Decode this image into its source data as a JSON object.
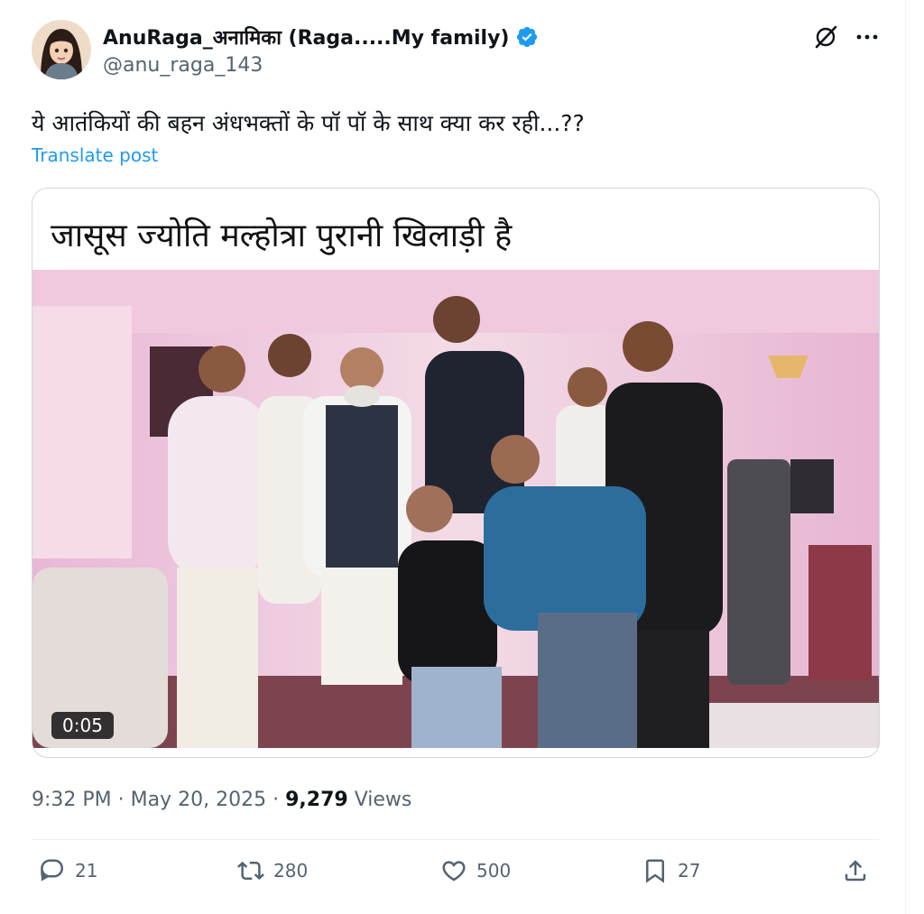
{
  "author": {
    "display_name": "AnuRaga_अनामिका (Raga.....My family)",
    "handle": "@anu_raga_143",
    "verified": true
  },
  "post": {
    "text": "ये आतंकियों की बहन अंधभक्तों के पॉ पॉ के साथ क्या कर रही...??",
    "translate_label": "Translate post"
  },
  "media": {
    "headline": "जासूस ज्योति मल्होत्रा पुरानी खिलाड़ी है",
    "duration": "0:05"
  },
  "meta": {
    "time": "9:32 PM",
    "date": "May 20, 2025",
    "views_count": "9,279",
    "views_label": "Views"
  },
  "actions": {
    "replies": "21",
    "reposts": "280",
    "likes": "500",
    "bookmarks": "27"
  },
  "icons": [
    "grok-icon",
    "more-icon",
    "reply-icon",
    "repost-icon",
    "like-icon",
    "bookmark-icon",
    "share-icon",
    "verified-icon"
  ],
  "colors": {
    "accent": "#1d9bf0",
    "text": "#0f1419",
    "secondary": "#536471"
  }
}
